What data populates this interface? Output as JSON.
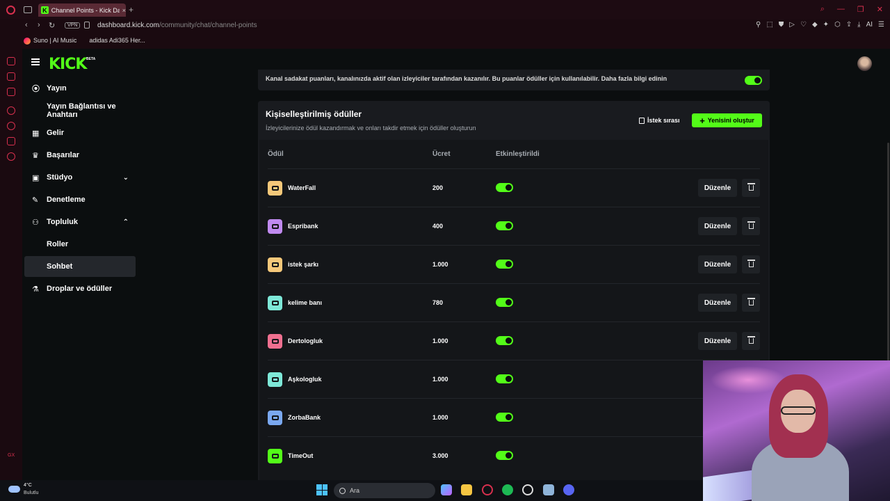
{
  "browser": {
    "tab_title": "Channel Points - Kick Dash",
    "tab_favicon": "K",
    "tab_close": "×",
    "new_tab": "+",
    "url_domain": "dashboard.kick.com",
    "url_path": "/community/chat/channel-points",
    "vpn_label": "VPN",
    "ai_label": "AI",
    "bookmarks": [
      "Suno | AI Music",
      "adidas Adi365 Her..."
    ],
    "gx_label": "GX"
  },
  "app": {
    "logo": "KICK",
    "beta": "BETA"
  },
  "sidebar": {
    "items": [
      {
        "label": "Yayın",
        "icon": "broadcast-icon"
      },
      {
        "label": "Yayın Bağlantısı ve Anahtarı"
      },
      {
        "label": "Gelir",
        "icon": "revenue-icon"
      },
      {
        "label": "Başarılar",
        "icon": "trophy-icon"
      },
      {
        "label": "Stüdyo",
        "icon": "studio-icon",
        "chevron": "⌄"
      },
      {
        "label": "Denetleme",
        "icon": "wrench-icon"
      },
      {
        "label": "Topluluk",
        "icon": "community-icon",
        "chevron": "⌃"
      },
      {
        "label": "Roller"
      },
      {
        "label": "Sohbet",
        "active": true
      },
      {
        "label": "Droplar ve ödüller",
        "icon": "drops-icon"
      }
    ]
  },
  "points_banner": {
    "text": "Kanal sadakat puanları, kanalınızda aktif olan izleyiciler tarafından kazanılır. Bu puanlar ödüller için kullanılabilir. Daha fazla bilgi edinin",
    "enabled": true
  },
  "rewards": {
    "title": "Kişiselleştirilmiş ödüller",
    "subtitle": "İzleyicilerinize ödül kazandırmak ve onları takdir etmek için ödüller oluşturun",
    "queue_button": "İstek sırası",
    "new_button": "Yenisini oluştur",
    "new_button_icon": "+",
    "columns": [
      "Ödül",
      "Ücret",
      "Etkinleştirildi"
    ],
    "edit_label": "Düzenle",
    "items": [
      {
        "name": "WaterFall",
        "cost": "200",
        "enabled": true,
        "color": "#f5c87a"
      },
      {
        "name": "Espribank",
        "cost": "400",
        "enabled": true,
        "color": "#c08af0"
      },
      {
        "name": "istek şarkı",
        "cost": "1.000",
        "enabled": true,
        "color": "#f5c87a"
      },
      {
        "name": "kelime banı",
        "cost": "780",
        "enabled": true,
        "color": "#7ee8d8"
      },
      {
        "name": "Dertologluk",
        "cost": "1.000",
        "enabled": true,
        "color": "#f07090"
      },
      {
        "name": "Aşkologluk",
        "cost": "1.000",
        "enabled": true,
        "color": "#7ee8d8"
      },
      {
        "name": "ZorbaBank",
        "cost": "1.000",
        "enabled": true,
        "color": "#7aa8f0"
      },
      {
        "name": "TimeOut",
        "cost": "3.000",
        "enabled": true,
        "color": "#53fc18"
      }
    ]
  },
  "taskbar": {
    "temperature": "4°C",
    "weather": "Bulutlu",
    "search_placeholder": "Ara"
  },
  "colors": {
    "accent": "#53fc18",
    "background": "#0b0e0f",
    "card": "#191b1f",
    "opera": "#d8304e"
  }
}
